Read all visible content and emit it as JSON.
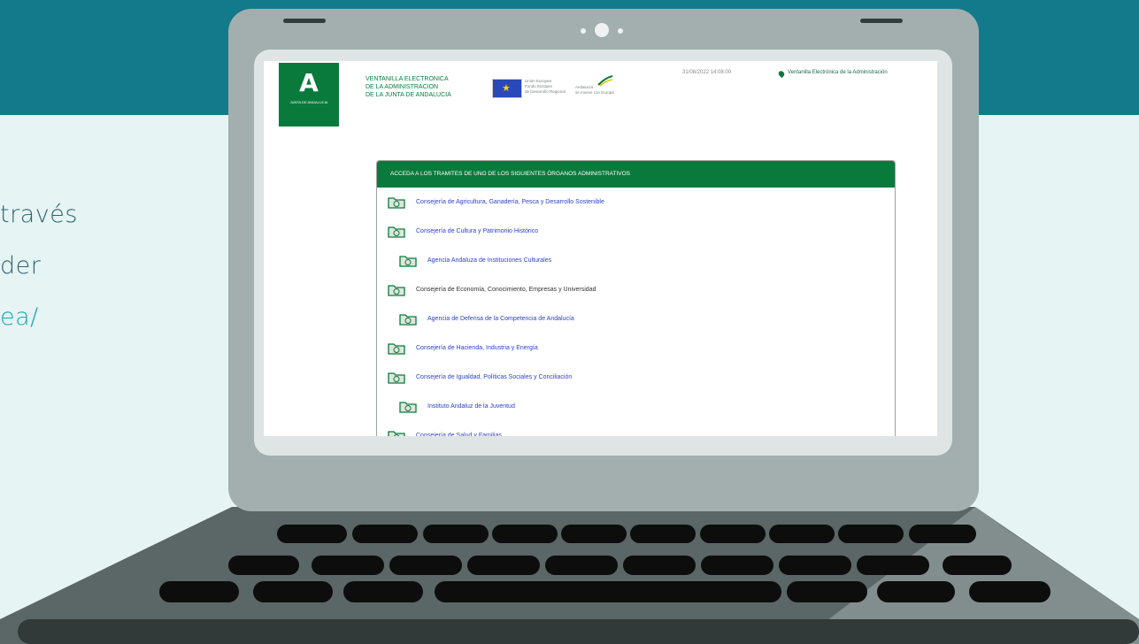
{
  "page": {
    "left_text": [
      "través",
      "der",
      "ea/"
    ]
  },
  "screen": {
    "logo": {
      "letter": "A",
      "subtitle": "JUNTA DE ANDALUCIA"
    },
    "site_title": [
      "VENTANILLA ELECTRONICA",
      "DE LA ADMINISTRACION",
      "DE LA JUNTA DE ANDALUCIA"
    ],
    "eu_text": [
      "Unión Europea",
      "Fondo Europeo",
      "de Desarrollo Regional"
    ],
    "andalucia_text": [
      "Andalucía",
      "se mueve con Europa"
    ],
    "datetime": "31/08/2022 14:08:00",
    "header_link": "Ventanilla Electrónica de la Administración",
    "panel_title": "ACCEDA A LOS TRAMITES DE UNO DE LOS SIGUIENTES ÓRGANOS ADMINISTRATIVOS",
    "organisms": [
      {
        "label": "Consejería de Agricultura, Ganadería, Pesca y Desarrollo Sostenible",
        "style": "link",
        "indent": 0
      },
      {
        "label": "Consejería de Cultura y Patrimonio Histórico",
        "style": "link",
        "indent": 0
      },
      {
        "label": "Agencia Andaluza de Instituciones Culturales",
        "style": "link",
        "indent": 1
      },
      {
        "label": "Consejería de Economía, Conocimiento, Empresas y Universidad",
        "style": "plain",
        "indent": 0
      },
      {
        "label": "Agencia de Defensa de la Competencia de Andalucía",
        "style": "link",
        "indent": 1
      },
      {
        "label": "Consejería de Hacienda, Industria y Energía",
        "style": "link",
        "indent": 0
      },
      {
        "label": "Consejería de Igualdad, Políticas Sociales y Conciliación",
        "style": "link",
        "indent": 0
      },
      {
        "label": "Instituto Andaluz de la Juventud",
        "style": "link",
        "indent": 1
      },
      {
        "label": "Consejería de Salud y Familias",
        "style": "link",
        "indent": 0
      }
    ]
  },
  "colors": {
    "band": "#137a8c",
    "background": "#e6f4f4",
    "junta_green": "#0a7a3c",
    "link_blue": "#2b3fd0",
    "laptop_gray": "#a3afaf",
    "key_black": "#0d0d0d"
  }
}
